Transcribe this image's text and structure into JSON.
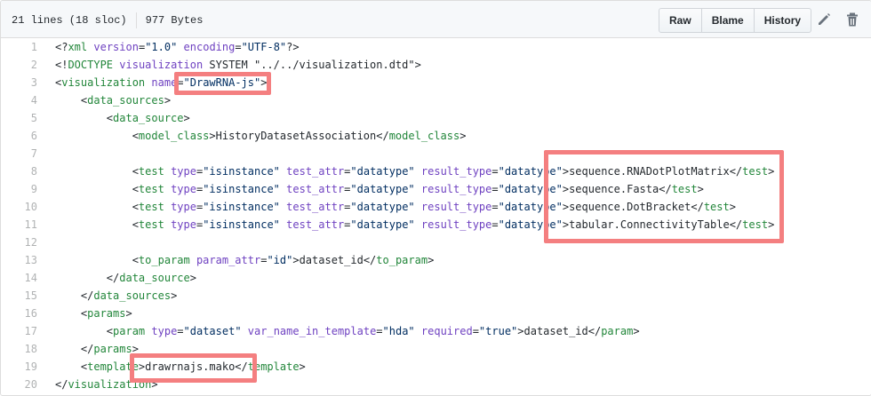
{
  "header": {
    "lines_info": "21 lines (18 sloc)",
    "size_info": "977 Bytes",
    "buttons": {
      "raw": "Raw",
      "blame": "Blame",
      "history": "History"
    }
  },
  "icons": {
    "edit": "pencil-icon",
    "delete": "trash-icon"
  },
  "colors": {
    "highlight": "#f47f80",
    "tag": "#22863a",
    "attr": "#6f42c1",
    "string": "#032f62"
  },
  "code": {
    "lines": [
      {
        "n": "1",
        "tokens": [
          [
            "p",
            "<?"
          ],
          [
            "t",
            "xml"
          ],
          [
            "p",
            " "
          ],
          [
            "a",
            "version"
          ],
          [
            "p",
            "="
          ],
          [
            "v",
            "\"1.0\""
          ],
          [
            "p",
            " "
          ],
          [
            "a",
            "encoding"
          ],
          [
            "p",
            "="
          ],
          [
            "v",
            "\"UTF-8\""
          ],
          [
            "p",
            "?>"
          ]
        ]
      },
      {
        "n": "2",
        "tokens": [
          [
            "p",
            "<!"
          ],
          [
            "t",
            "DOCTYPE"
          ],
          [
            "p",
            " "
          ],
          [
            "a",
            "visualization"
          ],
          [
            "p",
            " SYSTEM \"../../visualization.dtd\">"
          ]
        ]
      },
      {
        "n": "3",
        "tokens": [
          [
            "p",
            "<"
          ],
          [
            "t",
            "visualization"
          ],
          [
            "p",
            " "
          ],
          [
            "a",
            "name"
          ],
          [
            "p",
            "="
          ],
          [
            "v",
            "\"DrawRNA-js\""
          ],
          [
            "p",
            ">"
          ]
        ]
      },
      {
        "n": "4",
        "tokens": [
          [
            "p",
            "    <"
          ],
          [
            "t",
            "data_sources"
          ],
          [
            "p",
            ">"
          ]
        ]
      },
      {
        "n": "5",
        "tokens": [
          [
            "p",
            "        <"
          ],
          [
            "t",
            "data_source"
          ],
          [
            "p",
            ">"
          ]
        ]
      },
      {
        "n": "6",
        "tokens": [
          [
            "p",
            "            <"
          ],
          [
            "t",
            "model_class"
          ],
          [
            "p",
            ">HistoryDatasetAssociation</"
          ],
          [
            "t",
            "model_class"
          ],
          [
            "p",
            ">"
          ]
        ]
      },
      {
        "n": "7",
        "tokens": []
      },
      {
        "n": "8",
        "tokens": [
          [
            "p",
            "            <"
          ],
          [
            "t",
            "test"
          ],
          [
            "p",
            " "
          ],
          [
            "a",
            "type"
          ],
          [
            "p",
            "="
          ],
          [
            "v",
            "\"isinstance\""
          ],
          [
            "p",
            " "
          ],
          [
            "a",
            "test_attr"
          ],
          [
            "p",
            "="
          ],
          [
            "v",
            "\"datatype\""
          ],
          [
            "p",
            " "
          ],
          [
            "a",
            "result_type"
          ],
          [
            "p",
            "="
          ],
          [
            "v",
            "\"datatype\""
          ],
          [
            "p",
            ">sequence.RNADotPlotMatrix</"
          ],
          [
            "t",
            "test"
          ],
          [
            "p",
            ">"
          ]
        ]
      },
      {
        "n": "9",
        "tokens": [
          [
            "p",
            "            <"
          ],
          [
            "t",
            "test"
          ],
          [
            "p",
            " "
          ],
          [
            "a",
            "type"
          ],
          [
            "p",
            "="
          ],
          [
            "v",
            "\"isinstance\""
          ],
          [
            "p",
            " "
          ],
          [
            "a",
            "test_attr"
          ],
          [
            "p",
            "="
          ],
          [
            "v",
            "\"datatype\""
          ],
          [
            "p",
            " "
          ],
          [
            "a",
            "result_type"
          ],
          [
            "p",
            "="
          ],
          [
            "v",
            "\"datatype\""
          ],
          [
            "p",
            ">sequence.Fasta</"
          ],
          [
            "t",
            "test"
          ],
          [
            "p",
            ">"
          ]
        ]
      },
      {
        "n": "10",
        "tokens": [
          [
            "p",
            "            <"
          ],
          [
            "t",
            "test"
          ],
          [
            "p",
            " "
          ],
          [
            "a",
            "type"
          ],
          [
            "p",
            "="
          ],
          [
            "v",
            "\"isinstance\""
          ],
          [
            "p",
            " "
          ],
          [
            "a",
            "test_attr"
          ],
          [
            "p",
            "="
          ],
          [
            "v",
            "\"datatype\""
          ],
          [
            "p",
            " "
          ],
          [
            "a",
            "result_type"
          ],
          [
            "p",
            "="
          ],
          [
            "v",
            "\"datatype\""
          ],
          [
            "p",
            ">sequence.DotBracket</"
          ],
          [
            "t",
            "test"
          ],
          [
            "p",
            ">"
          ]
        ]
      },
      {
        "n": "11",
        "tokens": [
          [
            "p",
            "            <"
          ],
          [
            "t",
            "test"
          ],
          [
            "p",
            " "
          ],
          [
            "a",
            "type"
          ],
          [
            "p",
            "="
          ],
          [
            "v",
            "\"isinstance\""
          ],
          [
            "p",
            " "
          ],
          [
            "a",
            "test_attr"
          ],
          [
            "p",
            "="
          ],
          [
            "v",
            "\"datatype\""
          ],
          [
            "p",
            " "
          ],
          [
            "a",
            "result_type"
          ],
          [
            "p",
            "="
          ],
          [
            "v",
            "\"datatype\""
          ],
          [
            "p",
            ">tabular.ConnectivityTable</"
          ],
          [
            "t",
            "test"
          ],
          [
            "p",
            ">"
          ]
        ]
      },
      {
        "n": "12",
        "tokens": []
      },
      {
        "n": "13",
        "tokens": [
          [
            "p",
            "            <"
          ],
          [
            "t",
            "to_param"
          ],
          [
            "p",
            " "
          ],
          [
            "a",
            "param_attr"
          ],
          [
            "p",
            "="
          ],
          [
            "v",
            "\"id\""
          ],
          [
            "p",
            ">dataset_id</"
          ],
          [
            "t",
            "to_param"
          ],
          [
            "p",
            ">"
          ]
        ]
      },
      {
        "n": "14",
        "tokens": [
          [
            "p",
            "        </"
          ],
          [
            "t",
            "data_source"
          ],
          [
            "p",
            ">"
          ]
        ]
      },
      {
        "n": "15",
        "tokens": [
          [
            "p",
            "    </"
          ],
          [
            "t",
            "data_sources"
          ],
          [
            "p",
            ">"
          ]
        ]
      },
      {
        "n": "16",
        "tokens": [
          [
            "p",
            "    <"
          ],
          [
            "t",
            "params"
          ],
          [
            "p",
            ">"
          ]
        ]
      },
      {
        "n": "17",
        "tokens": [
          [
            "p",
            "        <"
          ],
          [
            "t",
            "param"
          ],
          [
            "p",
            " "
          ],
          [
            "a",
            "type"
          ],
          [
            "p",
            "="
          ],
          [
            "v",
            "\"dataset\""
          ],
          [
            "p",
            " "
          ],
          [
            "a",
            "var_name_in_template"
          ],
          [
            "p",
            "="
          ],
          [
            "v",
            "\"hda\""
          ],
          [
            "p",
            " "
          ],
          [
            "a",
            "required"
          ],
          [
            "p",
            "="
          ],
          [
            "v",
            "\"true\""
          ],
          [
            "p",
            ">dataset_id</"
          ],
          [
            "t",
            "param"
          ],
          [
            "p",
            ">"
          ]
        ]
      },
      {
        "n": "18",
        "tokens": [
          [
            "p",
            "    </"
          ],
          [
            "t",
            "params"
          ],
          [
            "p",
            ">"
          ]
        ]
      },
      {
        "n": "19",
        "tokens": [
          [
            "p",
            "    <"
          ],
          [
            "t",
            "template"
          ],
          [
            "p",
            ">drawrnajs.mako</"
          ],
          [
            "t",
            "template"
          ],
          [
            "p",
            ">"
          ]
        ]
      },
      {
        "n": "20",
        "tokens": [
          [
            "p",
            "</"
          ],
          [
            "t",
            "visualization"
          ],
          [
            "p",
            ">"
          ]
        ]
      }
    ]
  }
}
